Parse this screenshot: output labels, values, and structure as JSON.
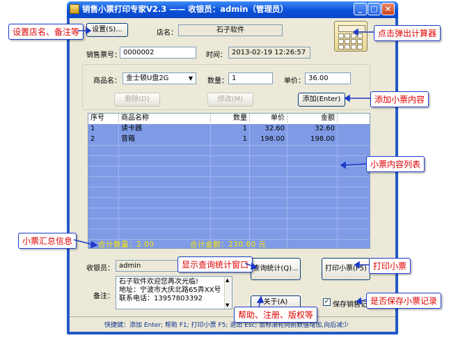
{
  "window": {
    "title": "销售小票打印专家V2.3 —— 收银员：admin（管理员）",
    "min_glyph": "_",
    "max_glyph": "□",
    "close_glyph": "×"
  },
  "settings_button": "设置(S)...",
  "store": {
    "label": "店名：",
    "value": "石子软件"
  },
  "ticket": {
    "label": "销售票号：",
    "value": "0000002"
  },
  "time": {
    "label": "时间：",
    "value": "2013-02-19 12:26:57"
  },
  "product": {
    "name_label": "商品名：",
    "name_value": "金士顿U盘2G",
    "qty_label": "数量：",
    "qty_value": "1",
    "price_label": "单价：",
    "price_value": "36.00"
  },
  "buttons": {
    "delete": "删除(D)",
    "modify": "修改(M)",
    "add": "添加(Enter)",
    "query": "查询统计(Q)...",
    "print": "打印小票(F5)",
    "about": "关于(A)"
  },
  "table": {
    "headers": [
      "序号",
      "商品名称",
      "数量",
      "单价",
      "金额"
    ],
    "rows": [
      [
        "1",
        "读卡器",
        "1",
        "32.60",
        "32.60"
      ],
      [
        "2",
        "音箱",
        "1",
        "198.00",
        "198.00"
      ]
    ]
  },
  "summary": {
    "qty": "合计数量：2.00",
    "amount": "合计金额：230.60 元"
  },
  "cashier": {
    "label": "收银员：",
    "value": "admin"
  },
  "remark": {
    "label": "备注：",
    "lines": [
      "石子软件欢迎您再次光临!",
      "地址：宁波市大庆北路65弄XX号",
      "联系电话：13957803392"
    ]
  },
  "save_checkbox": {
    "label": "保存销售记录",
    "checked": true
  },
  "status_bar": "快捷键：添加 Enter; 帮助 F1; 打印小票 F5; 退出 Esc; 鼠标滚轮向前数值增加,向后减少",
  "annotations": {
    "settings": "设置店名、备注等",
    "calculator": "点击弹出计算器",
    "add_content": "添加小票内容",
    "list": "小票内容列表",
    "summary": "小票汇总信息",
    "query": "显示查询统计窗口",
    "print": "打印小票",
    "help": "帮助、注册、版权等",
    "save": "是否保存小票记录"
  },
  "colors": {
    "annotation_text": "#e00000",
    "annotation_border": "#1a39c7",
    "grid_bg": "#7f9be6",
    "summary_text": "#ffe600"
  }
}
